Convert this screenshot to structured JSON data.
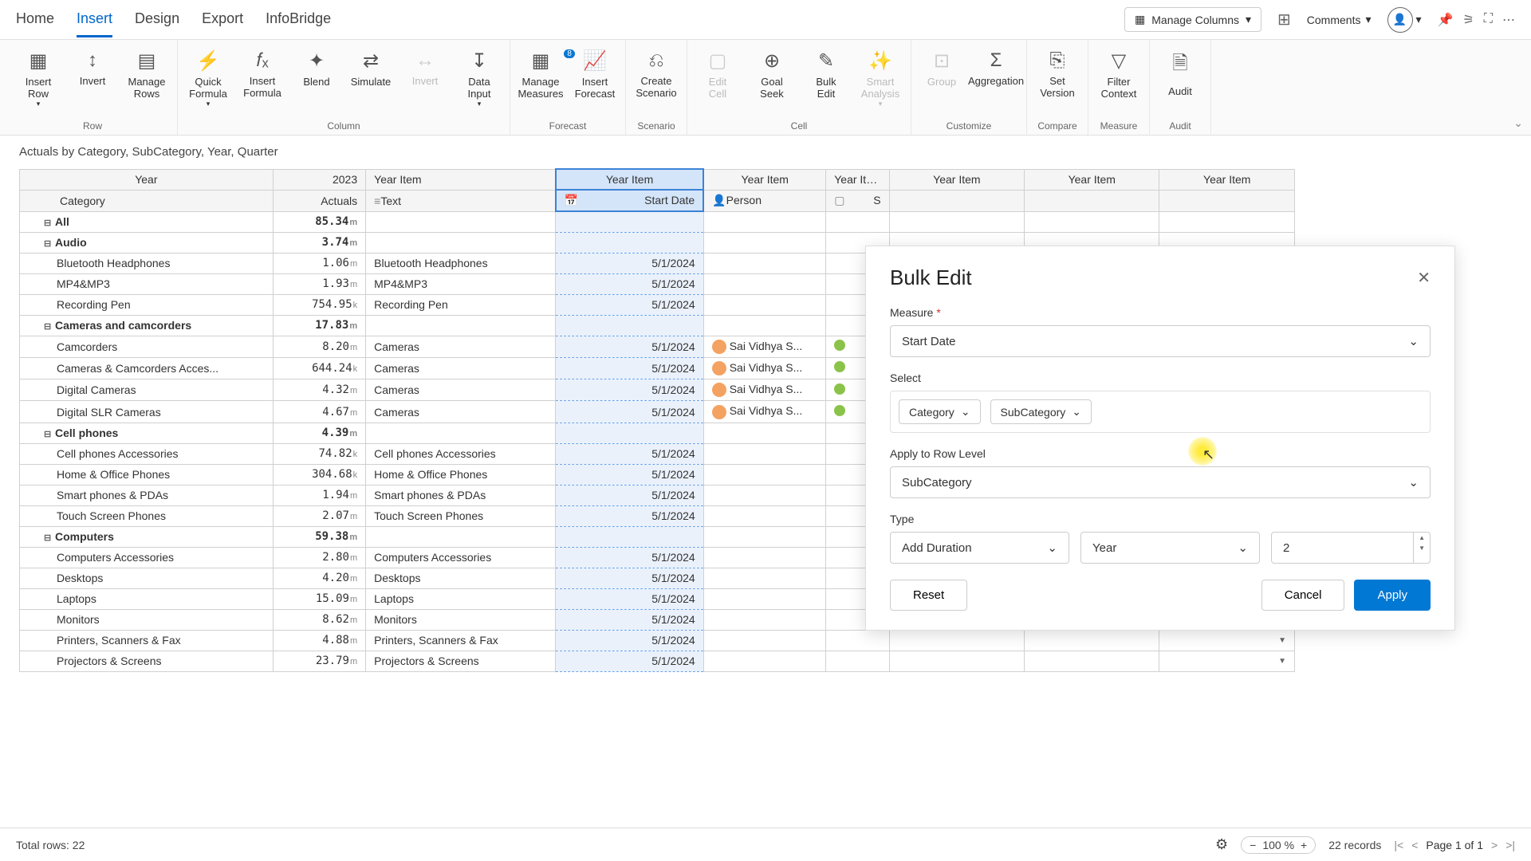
{
  "menu": {
    "tabs": [
      "Home",
      "Insert",
      "Design",
      "Export",
      "InfoBridge"
    ],
    "active": 1,
    "manage_columns": "Manage Columns",
    "comments": "Comments"
  },
  "ribbon": {
    "groups": [
      {
        "label": "Row",
        "buttons": [
          {
            "label": "Insert Row",
            "sub": "▾",
            "icon": "▦"
          },
          {
            "label": "Invert",
            "icon": "↕"
          },
          {
            "label": "Manage Rows",
            "icon": "▤"
          }
        ]
      },
      {
        "label": "Column",
        "buttons": [
          {
            "label": "Quick Formula",
            "sub": "▾",
            "icon": "⚡"
          },
          {
            "label": "Insert Formula",
            "icon": "𝑓ₓ"
          },
          {
            "label": "Blend",
            "icon": "✦"
          },
          {
            "label": "Simulate",
            "icon": "⇄"
          },
          {
            "label": "Invert",
            "icon": "↔",
            "disabled": true
          },
          {
            "label": "Data Input",
            "sub": "▾",
            "icon": "↧"
          }
        ]
      },
      {
        "label": "Forecast",
        "buttons": [
          {
            "label": "Manage Measures",
            "icon": "▦",
            "badge": "8"
          },
          {
            "label": "Insert Forecast",
            "icon": "📈"
          }
        ]
      },
      {
        "label": "Scenario",
        "buttons": [
          {
            "label": "Create Scenario",
            "icon": "⎌"
          }
        ]
      },
      {
        "label": "Cell",
        "buttons": [
          {
            "label": "Edit Cell",
            "icon": "▢",
            "disabled": true
          },
          {
            "label": "Goal Seek",
            "icon": "⊕"
          },
          {
            "label": "Bulk Edit",
            "icon": "✎"
          },
          {
            "label": "Smart Analysis",
            "sub": "▾",
            "icon": "✨",
            "disabled": true
          }
        ]
      },
      {
        "label": "Customize",
        "buttons": [
          {
            "label": "Group",
            "icon": "⊡",
            "disabled": true
          },
          {
            "label": "Aggregation",
            "icon": "Σ"
          }
        ]
      },
      {
        "label": "Compare",
        "buttons": [
          {
            "label": "Set Version",
            "icon": "⎘"
          }
        ]
      },
      {
        "label": "Measure",
        "buttons": [
          {
            "label": "Filter Context",
            "icon": "▽"
          }
        ]
      },
      {
        "label": "Audit",
        "buttons": [
          {
            "label": "Audit",
            "icon": "🗎"
          }
        ]
      }
    ]
  },
  "breadcrumb": "Actuals by Category, SubCategory, Year, Quarter",
  "table": {
    "headers": {
      "year": "Year",
      "y2023": "2023",
      "year_item": "Year Item",
      "category": "Category",
      "actuals": "Actuals",
      "text": "Text",
      "start_date": "Start Date",
      "person": "Person",
      "s": "S"
    },
    "rows": [
      {
        "level": 0,
        "cat": "All",
        "expand": true,
        "val": "85.34",
        "unit": "m"
      },
      {
        "level": 0,
        "cat": "Audio",
        "expand": true,
        "val": "3.74",
        "unit": "m",
        "bold": true
      },
      {
        "level": 1,
        "cat": "Bluetooth Headphones",
        "val": "1.06",
        "unit": "m",
        "text": "Bluetooth Headphones",
        "date": "5/1/2024"
      },
      {
        "level": 1,
        "cat": "MP4&MP3",
        "val": "1.93",
        "unit": "m",
        "text": "MP4&MP3",
        "date": "5/1/2024"
      },
      {
        "level": 1,
        "cat": "Recording Pen",
        "val": "754.95",
        "unit": "k",
        "text": "Recording Pen",
        "date": "5/1/2024"
      },
      {
        "level": 0,
        "cat": "Cameras and camcorders",
        "expand": true,
        "val": "17.83",
        "unit": "m",
        "bold": true
      },
      {
        "level": 1,
        "cat": "Camcorders",
        "val": "8.20",
        "unit": "m",
        "text": "Cameras",
        "date": "5/1/2024",
        "person": "Sai Vidhya S...",
        "status": true
      },
      {
        "level": 1,
        "cat": "Cameras & Camcorders Acces...",
        "val": "644.24",
        "unit": "k",
        "text": "Cameras",
        "date": "5/1/2024",
        "person": "Sai Vidhya S...",
        "status": true
      },
      {
        "level": 1,
        "cat": "Digital Cameras",
        "val": "4.32",
        "unit": "m",
        "text": "Cameras",
        "date": "5/1/2024",
        "person": "Sai Vidhya S...",
        "status": true
      },
      {
        "level": 1,
        "cat": "Digital SLR Cameras",
        "val": "4.67",
        "unit": "m",
        "text": "Cameras",
        "date": "5/1/2024",
        "person": "Sai Vidhya S...",
        "status": true
      },
      {
        "level": 0,
        "cat": "Cell phones",
        "expand": true,
        "val": "4.39",
        "unit": "m",
        "bold": true
      },
      {
        "level": 1,
        "cat": "Cell phones Accessories",
        "val": "74.82",
        "unit": "k",
        "text": "Cell phones Accessories",
        "date": "5/1/2024"
      },
      {
        "level": 1,
        "cat": "Home & Office Phones",
        "val": "304.68",
        "unit": "k",
        "text": "Home & Office Phones",
        "date": "5/1/2024"
      },
      {
        "level": 1,
        "cat": "Smart phones & PDAs",
        "val": "1.94",
        "unit": "m",
        "text": "Smart phones & PDAs",
        "date": "5/1/2024"
      },
      {
        "level": 1,
        "cat": "Touch Screen Phones",
        "val": "2.07",
        "unit": "m",
        "text": "Touch Screen Phones",
        "date": "5/1/2024"
      },
      {
        "level": 0,
        "cat": "Computers",
        "expand": true,
        "val": "59.38",
        "unit": "m",
        "bold": true
      },
      {
        "level": 1,
        "cat": "Computers Accessories",
        "val": "2.80",
        "unit": "m",
        "text": "Computers Accessories",
        "date": "5/1/2024"
      },
      {
        "level": 1,
        "cat": "Desktops",
        "val": "4.20",
        "unit": "m",
        "text": "Desktops",
        "date": "5/1/2024"
      },
      {
        "level": 1,
        "cat": "Laptops",
        "val": "15.09",
        "unit": "m",
        "text": "Laptops",
        "date": "5/1/2024",
        "dd": true
      },
      {
        "level": 1,
        "cat": "Monitors",
        "val": "8.62",
        "unit": "m",
        "text": "Monitors",
        "date": "5/1/2024",
        "dd": true
      },
      {
        "level": 1,
        "cat": "Printers, Scanners & Fax",
        "val": "4.88",
        "unit": "m",
        "text": "Printers, Scanners & Fax",
        "date": "5/1/2024",
        "dd": true
      },
      {
        "level": 1,
        "cat": "Projectors & Screens",
        "val": "23.79",
        "unit": "m",
        "text": "Projectors & Screens",
        "date": "5/1/2024",
        "dd": true
      }
    ]
  },
  "panel": {
    "title": "Bulk Edit",
    "measure_label": "Measure",
    "measure_value": "Start Date",
    "select_label": "Select",
    "chip_category": "Category",
    "chip_subcategory": "SubCategory",
    "apply_row_label": "Apply to Row Level",
    "apply_row_value": "SubCategory",
    "type_label": "Type",
    "type_value": "Add Duration",
    "unit_value": "Year",
    "num_value": "2",
    "reset": "Reset",
    "cancel": "Cancel",
    "apply": "Apply"
  },
  "status": {
    "total_rows": "Total rows: 22",
    "zoom": "100 %",
    "records": "22 records",
    "page": "Page 1 of 1"
  }
}
